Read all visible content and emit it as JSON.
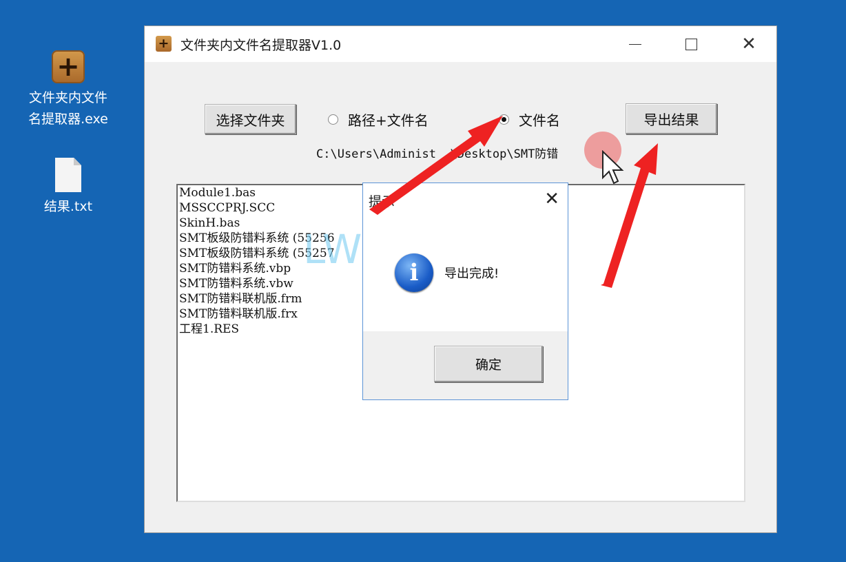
{
  "desktop": {
    "app_icon_label": "文件夹内文件名提取器.exe",
    "app_icon_label_line1": "文件夹内文件",
    "app_icon_label_line2": "名提取器.exe",
    "txt_icon_label": "结果.txt"
  },
  "window": {
    "title": "文件夹内文件名提取器V1.0",
    "buttons": {
      "minimize": "minimize",
      "maximize": "maximize",
      "close": "close"
    }
  },
  "toolbar": {
    "select_folder_label": "选择文件夹",
    "radio_path_name_label": "路径+文件名",
    "radio_name_label": "文件名",
    "export_label": "导出结果",
    "selected_option": "文件名"
  },
  "path_display": "C:\\Users\\Administ",
  "path_display_tail": "\\Desktop\\SMT防错",
  "path_display_mid": "or",
  "file_list": [
    "Module1.bas",
    "MSSCCPRJ.SCC",
    "SkinH.bas",
    "SMT板级防错料系统 (55256",
    "SMT板级防错料系统 (55257",
    "SMT防错料系统.vbp",
    "SMT防错料系统.vbw",
    "SMT防错料联机版.frm",
    "SMT防错料联机版.frx",
    "工程1.RES"
  ],
  "dialog": {
    "title": "提示",
    "message": "导出完成!",
    "ok_label": "确定",
    "icon": "info-icon"
  },
  "watermark": "LW50.COM",
  "colors": {
    "desktop": "#1565b4",
    "arrow": "#ee2222",
    "dialog_border": "#5b93d6"
  }
}
